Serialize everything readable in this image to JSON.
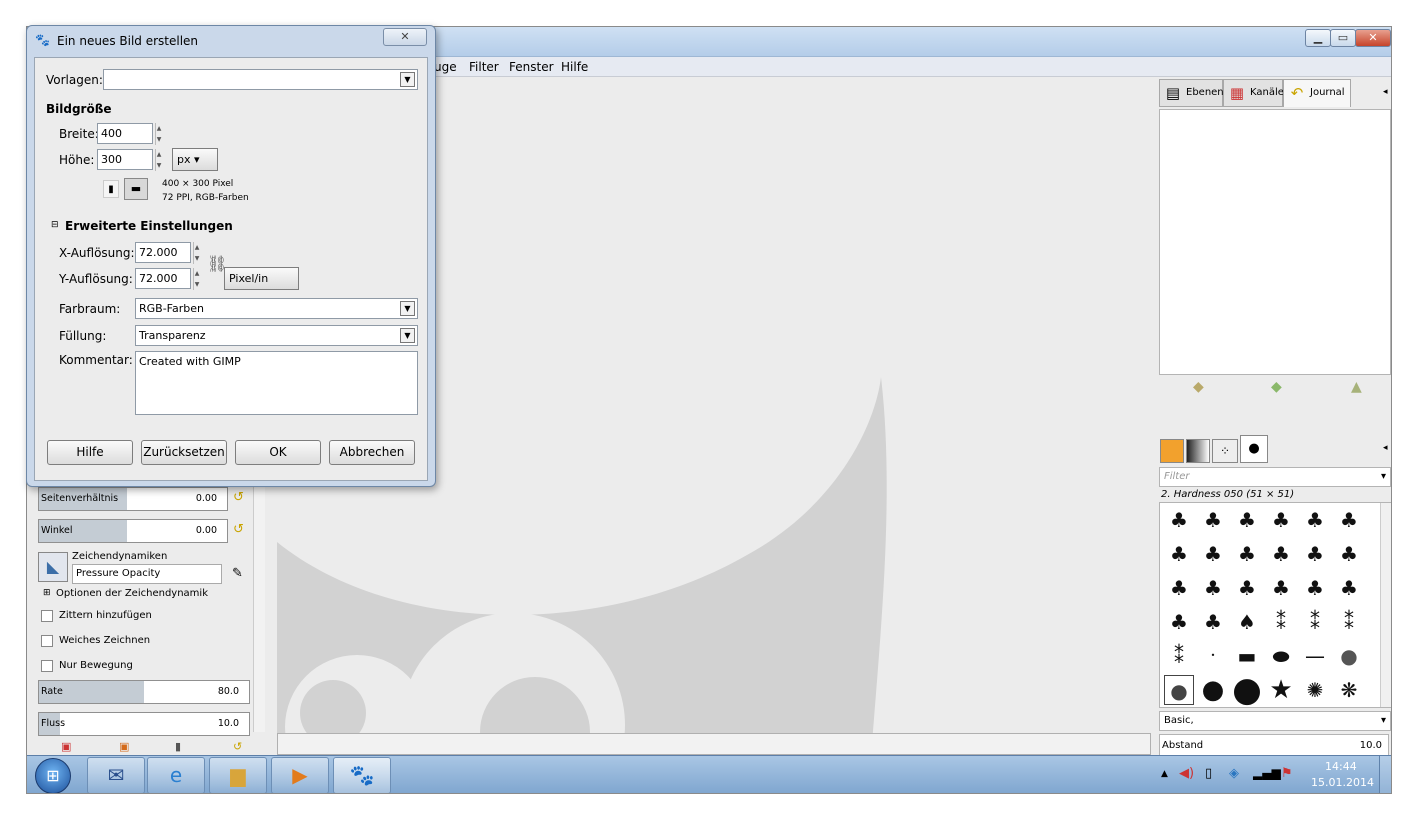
{
  "main_window": {
    "menu": {
      "item_partial": "uge",
      "filter": "Filter",
      "fenster": "Fenster",
      "hilfe": "Hilfe"
    }
  },
  "right_dock": {
    "tabs": [
      {
        "label": "Ebenen",
        "icon": "layers-icon"
      },
      {
        "label": "Kanäle",
        "icon": "channels-icon"
      },
      {
        "label": "Journal",
        "icon": "undo-history-icon"
      }
    ],
    "brush_filter_placeholder": "Filter",
    "brush_name": "2. Hardness 050 (51 × 51)",
    "brush_preset": "Basic,",
    "abstand": {
      "label": "Abstand",
      "value": "10.0"
    }
  },
  "tool_options": {
    "seitenverhaeltnis": {
      "label": "Seitenverhältnis",
      "value": "0.00",
      "fill": 0.47
    },
    "winkel": {
      "label": "Winkel",
      "value": "0.00",
      "fill": 0.47
    },
    "zeichendynamiken_label": "Zeichendynamiken",
    "zeichendynamiken_value": "Pressure Opacity",
    "optionen_dynamik": "Optionen der Zeichendynamik",
    "zittern": "Zittern hinzufügen",
    "weiches": "Weiches Zeichnen",
    "nur_bewegung": "Nur Bewegung",
    "rate": {
      "label": "Rate",
      "value": "80.0",
      "fill": 0.5
    },
    "fluss": {
      "label": "Fluss",
      "value": "10.0",
      "fill": 0.1
    }
  },
  "taskbar": {
    "time": "14:44",
    "date": "15.01.2014"
  },
  "dialog": {
    "title": "Ein neues Bild erstellen",
    "vorlagen_label": "Vorlagen:",
    "vorlagen_value": "",
    "bildgroesse_heading": "Bildgröße",
    "breite_label": "Breite:",
    "breite_value": "400",
    "hoehe_label": "Höhe:",
    "hoehe_value": "300",
    "unit": "px",
    "size_info": "400 × 300 Pixel",
    "res_info": "72 PPI, RGB-Farben",
    "erweitert_heading": "Erweiterte Einstellungen",
    "x_label": "X-Auflösung:",
    "x_value": "72.000",
    "y_label": "Y-Auflösung:",
    "y_value": "72.000",
    "res_unit": "Pixel/in",
    "farbraum_label": "Farbraum:",
    "farbraum_value": "RGB-Farben",
    "fuellung_label": "Füllung:",
    "fuellung_value": "Transparenz",
    "kommentar_label": "Kommentar:",
    "kommentar_value": "Created with GIMP",
    "buttons": {
      "hilfe": "Hilfe",
      "zuruecksetzen": "Zurücksetzen",
      "ok": "OK",
      "abbrechen": "Abbrechen"
    }
  }
}
